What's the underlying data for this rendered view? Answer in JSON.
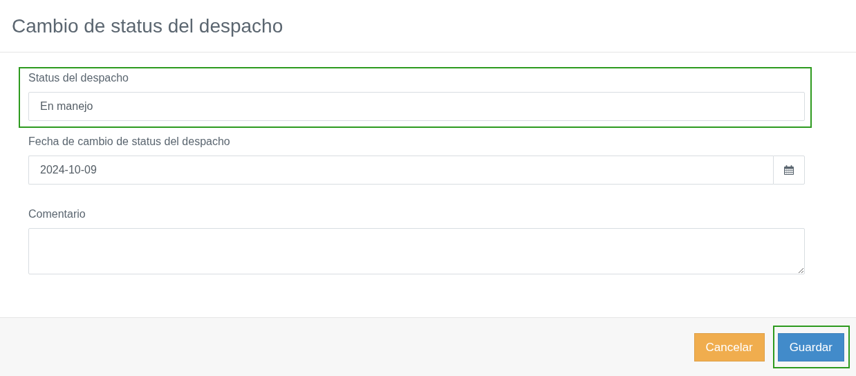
{
  "title": "Cambio de status del despacho",
  "fields": [
    {
      "kind": "select",
      "label": "Status del despacho",
      "value": "En manejo",
      "highlighted": true
    },
    {
      "kind": "date",
      "label": "Fecha de cambio de status del despacho",
      "value": "2024-10-09",
      "highlighted": false
    },
    {
      "kind": "textarea",
      "label": "Comentario",
      "highlighted": false
    }
  ],
  "buttons": [
    {
      "kind": "warning",
      "label": "Cancelar",
      "highlighted": false
    },
    {
      "kind": "primary",
      "label": "Guardar",
      "highlighted": true
    }
  ]
}
